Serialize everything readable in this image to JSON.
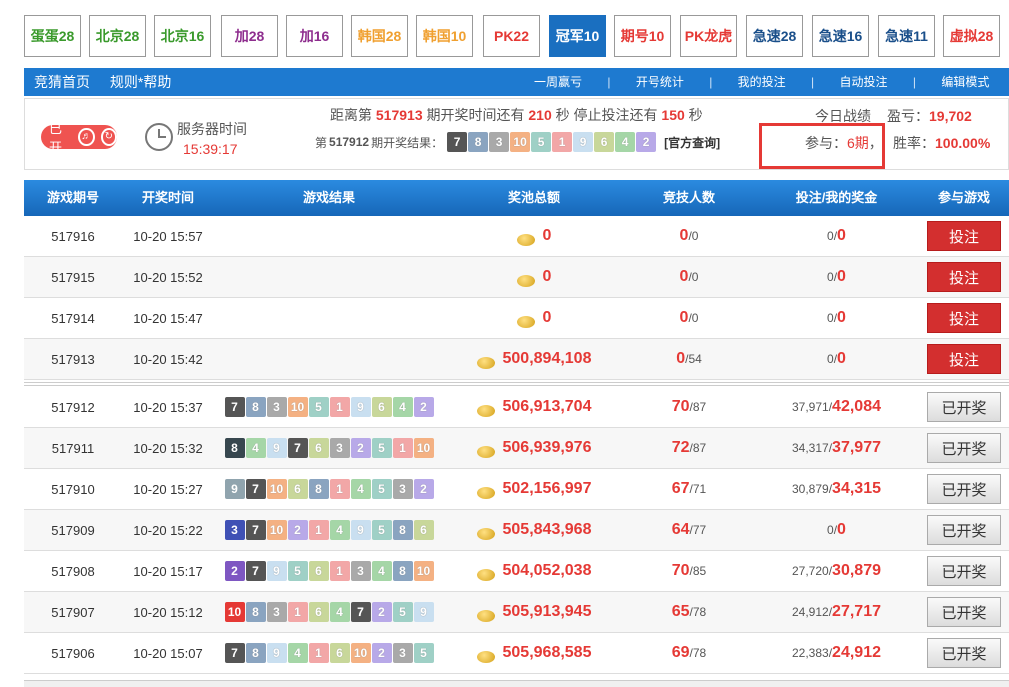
{
  "tabs": [
    {
      "label": "蛋蛋28",
      "color": "#3a9a2c",
      "active": false
    },
    {
      "label": "北京28",
      "color": "#3a9a2c",
      "active": false
    },
    {
      "label": "北京16",
      "color": "#3a9a2c",
      "active": false
    },
    {
      "label": "加28",
      "color": "#8e2d8e",
      "active": false
    },
    {
      "label": "加16",
      "color": "#8e2d8e",
      "active": false
    },
    {
      "label": "韩国28",
      "color": "#f0a030",
      "active": false
    },
    {
      "label": "韩国10",
      "color": "#f0a030",
      "active": false
    },
    {
      "label": "PK22",
      "color": "#e53935",
      "active": false
    },
    {
      "label": "冠军10",
      "color": "#ffffff",
      "active": true
    },
    {
      "label": "期号10",
      "color": "#e53935",
      "active": false
    },
    {
      "label": "PK龙虎",
      "color": "#e53935",
      "active": false
    },
    {
      "label": "急速28",
      "color": "#1a4f8a",
      "active": false
    },
    {
      "label": "急速16",
      "color": "#1a4f8a",
      "active": false
    },
    {
      "label": "急速11",
      "color": "#1a4f8a",
      "active": false
    },
    {
      "label": "虚拟28",
      "color": "#e53935",
      "active": false
    }
  ],
  "nav": {
    "left": [
      "竞猜首页",
      "规则*帮助"
    ],
    "right": [
      "一周赢亏",
      "开号统计",
      "我的投注",
      "自动投注",
      "编辑模式"
    ],
    "separator": "|"
  },
  "info": {
    "open_label": "已开",
    "server_label": "服务器时间",
    "server_time": "15:39:17",
    "countdown": {
      "prefix": "距离第",
      "issue": "517913",
      "mid1": "期开奖时间还有",
      "sec1": "210",
      "mid2": "秒 停止投注还有",
      "sec2": "150",
      "suffix": "秒"
    },
    "last_result": {
      "prefix": "第",
      "issue": "517912",
      "suffix": "期开奖结果：",
      "balls": [
        7,
        8,
        3,
        10,
        5,
        1,
        9,
        6,
        4,
        2
      ],
      "official_link": "[官方查询]"
    },
    "today_label": "今日战绩",
    "profit_label": "盈亏：",
    "profit_value": "19,702",
    "join_label": "参与：",
    "join_value": "6期",
    "join_sep": "，",
    "rate_label": "胜率：",
    "rate_value": "100.00%"
  },
  "table": {
    "headers": [
      "游戏期号",
      "开奖时间",
      "游戏结果",
      "奖池总额",
      "竞技人数",
      "投注/我的奖金",
      "参与游戏"
    ],
    "bet_label": "投注",
    "done_label": "已开奖",
    "upcoming": [
      {
        "issue": "517916",
        "time": "10-20 15:57",
        "pool": "0",
        "players": "0",
        "players_total": "/0",
        "bet": "0/",
        "win": "0"
      },
      {
        "issue": "517915",
        "time": "10-20 15:52",
        "pool": "0",
        "players": "0",
        "players_total": "/0",
        "bet": "0/",
        "win": "0"
      },
      {
        "issue": "517914",
        "time": "10-20 15:47",
        "pool": "0",
        "players": "0",
        "players_total": "/0",
        "bet": "0/",
        "win": "0"
      },
      {
        "issue": "517913",
        "time": "10-20 15:42",
        "pool": "500,894,108",
        "players": "0",
        "players_total": "/54",
        "bet": "0/",
        "win": "0"
      }
    ],
    "finished": [
      {
        "issue": "517912",
        "time": "10-20 15:37",
        "balls": [
          7,
          8,
          3,
          10,
          5,
          1,
          9,
          6,
          4,
          2
        ],
        "pool": "506,913,704",
        "players": "70",
        "players_total": "/87",
        "bet": "37,971/",
        "win": "42,084"
      },
      {
        "issue": "517911",
        "time": "10-20 15:32",
        "balls": [
          8,
          4,
          9,
          7,
          6,
          3,
          2,
          5,
          1,
          10
        ],
        "pool": "506,939,976",
        "players": "72",
        "players_total": "/87",
        "bet": "34,317/",
        "win": "37,977"
      },
      {
        "issue": "517910",
        "time": "10-20 15:27",
        "balls": [
          9,
          7,
          10,
          6,
          8,
          1,
          4,
          5,
          3,
          2
        ],
        "pool": "502,156,997",
        "players": "67",
        "players_total": "/71",
        "bet": "30,879/",
        "win": "34,315"
      },
      {
        "issue": "517909",
        "time": "10-20 15:22",
        "balls": [
          3,
          7,
          10,
          2,
          1,
          4,
          9,
          5,
          8,
          6
        ],
        "pool": "505,843,968",
        "players": "64",
        "players_total": "/77",
        "bet": "0/",
        "win": "0"
      },
      {
        "issue": "517908",
        "time": "10-20 15:17",
        "balls": [
          2,
          7,
          9,
          5,
          6,
          1,
          3,
          4,
          8,
          10
        ],
        "pool": "504,052,038",
        "players": "70",
        "players_total": "/85",
        "bet": "27,720/",
        "win": "30,879"
      },
      {
        "issue": "517907",
        "time": "10-20 15:12",
        "balls": [
          10,
          8,
          3,
          1,
          6,
          4,
          7,
          2,
          5,
          9
        ],
        "pool": "505,913,945",
        "players": "65",
        "players_total": "/78",
        "bet": "24,912/",
        "win": "27,717"
      },
      {
        "issue": "517906",
        "time": "10-20 15:07",
        "balls": [
          7,
          8,
          9,
          4,
          1,
          6,
          10,
          2,
          3,
          5
        ],
        "pool": "505,968,585",
        "players": "69",
        "players_total": "/78",
        "bet": "22,383/",
        "win": "24,912"
      }
    ]
  },
  "ball_colors": {
    "1": "#f2a7a7",
    "2": "#b8a9e8",
    "3": "#a9a9a9",
    "4": "#a5d6a7",
    "5": "#9fd0c6",
    "6": "#c8d79a",
    "7": "#555555",
    "8": "#8aa4c0",
    "9": "#c9dff0",
    "10": "#f4b183"
  },
  "ball_colors_strong": {
    "1": "#e06666",
    "2": "#7e57c2",
    "3": "#3f51b5",
    "4": "#66bb6a",
    "5": "#26a69a",
    "6": "#9e9d24",
    "7": "#555555",
    "8": "#37474f",
    "9": "#90a4ae",
    "10": "#e53935"
  }
}
